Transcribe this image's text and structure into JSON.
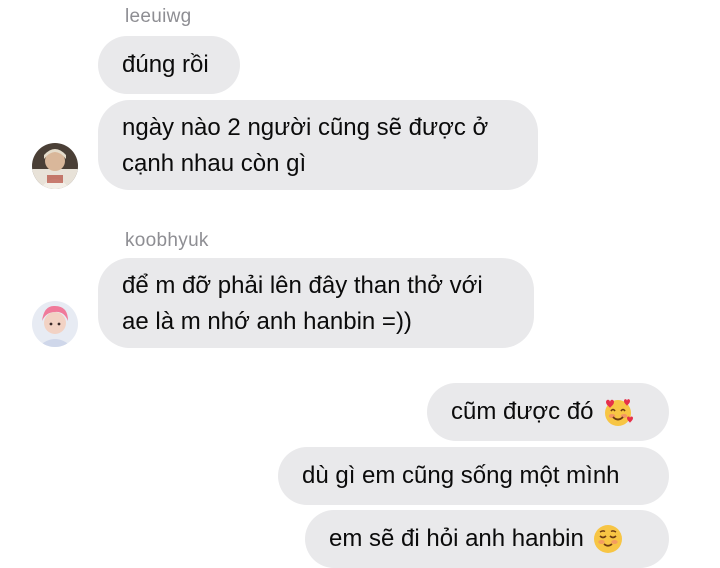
{
  "conversation": {
    "groups": [
      {
        "sender": "leeuiwg",
        "messages": [
          "đúng rồi",
          "ngày nào 2 người cũng sẽ được ở\ncạnh nhau còn gì"
        ]
      },
      {
        "sender": "koobhyuk",
        "messages": [
          "để m đỡ phải lên đây than thở với\nae là m nhớ anh hanbin =))"
        ]
      }
    ],
    "outgoing": [
      {
        "text": "cũm được đó",
        "emoji": "smiling-face-with-hearts-icon"
      },
      {
        "text": "dù gì em cũng sống một mình"
      },
      {
        "text": "em sẽ đi hỏi anh hanbin",
        "emoji": "relieved-face-icon"
      }
    ]
  },
  "colors": {
    "bubble": "#e9e9eb",
    "sender_name": "#8e8e93",
    "text": "#0b0b0b"
  }
}
